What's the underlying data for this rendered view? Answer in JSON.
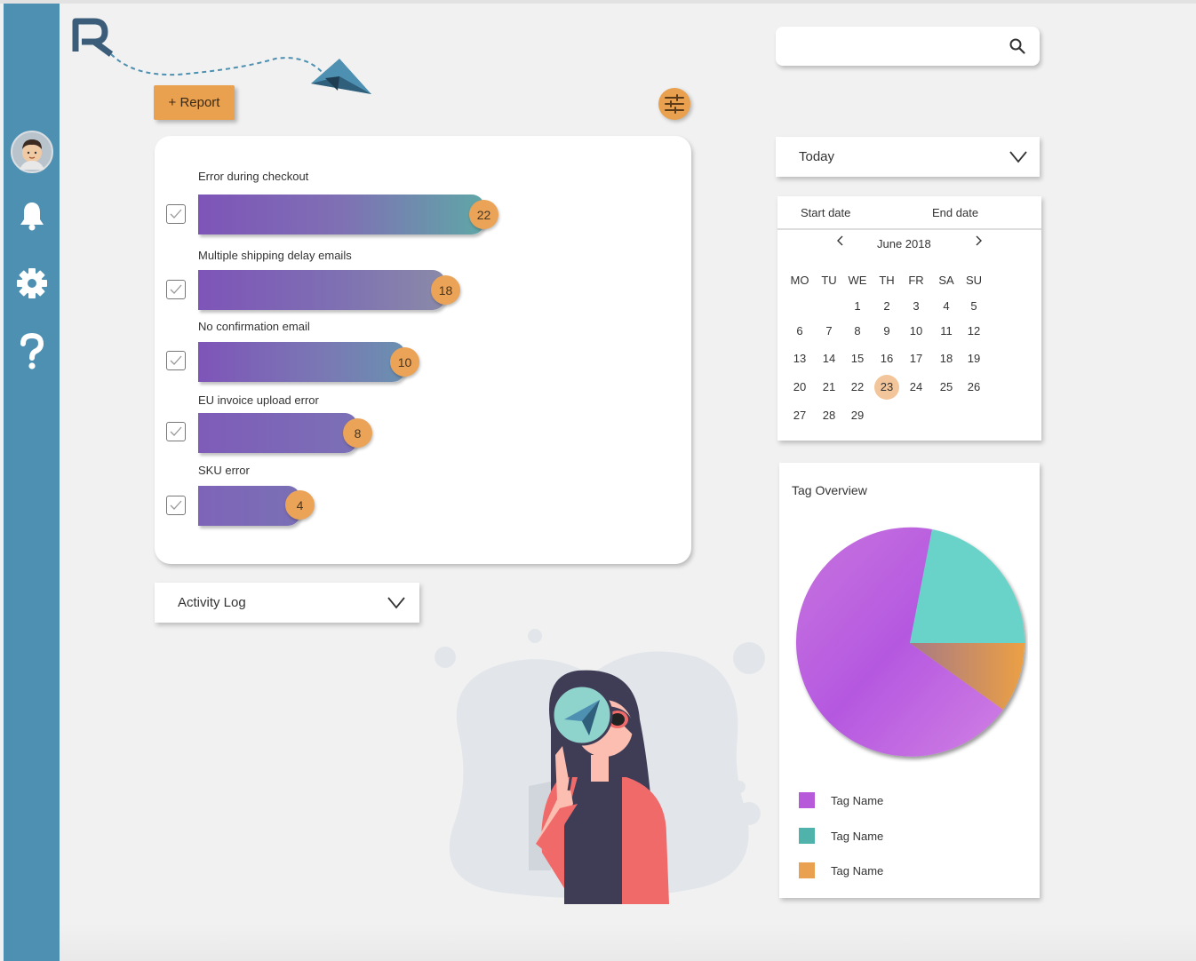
{
  "sidebar": {
    "icons": [
      "avatar",
      "bell-icon",
      "gear-icon",
      "help-icon"
    ]
  },
  "toolbar": {
    "report_label": "+ Report"
  },
  "issues": [
    {
      "label": "Error during checkout",
      "count": "22"
    },
    {
      "label": "Multiple shipping delay emails",
      "count": "18"
    },
    {
      "label": "No confirmation email",
      "count": "10"
    },
    {
      "label": "EU invoice upload error",
      "count": "8"
    },
    {
      "label": "SKU error",
      "count": "4"
    }
  ],
  "activity_log": {
    "label": "Activity Log"
  },
  "search": {
    "placeholder": ""
  },
  "range_select": {
    "value": "Today"
  },
  "calendar": {
    "start_label": "Start date",
    "end_label": "End date",
    "month": "June 2018",
    "weekdays": [
      "MO",
      "TU",
      "WE",
      "TH",
      "FR",
      "SA",
      "SU"
    ],
    "days": [
      "1",
      "2",
      "3",
      "4",
      "5",
      "6",
      "7",
      "8",
      "9",
      "10",
      "11",
      "12",
      "13",
      "14",
      "15",
      "16",
      "17",
      "18",
      "19",
      "20",
      "21",
      "22",
      "23",
      "24",
      "25",
      "26",
      "27",
      "28",
      "29"
    ],
    "first_weekday_index": 2,
    "selected_day": "23"
  },
  "tag_overview": {
    "title": "Tag Overview",
    "legend": [
      {
        "label": "Tag Name",
        "color": "#b75ad9"
      },
      {
        "label": "Tag Name",
        "color": "#4fb3ab"
      },
      {
        "label": "Tag Name",
        "color": "#e9a04f"
      }
    ]
  },
  "colors": {
    "sidebar": "#4e90b1",
    "accent": "#e9a04f",
    "bar_gradient_start": "#7e54b8",
    "bar_gradient_end": "#5fa7a7"
  }
}
